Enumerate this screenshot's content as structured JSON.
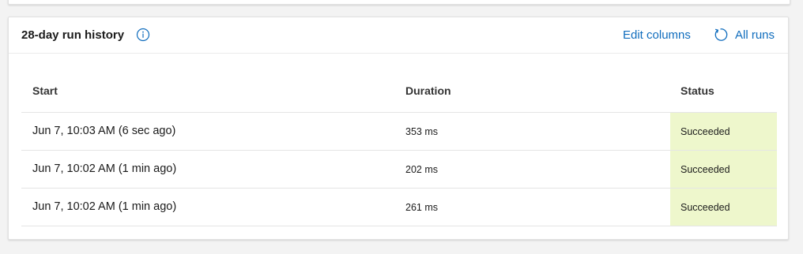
{
  "card": {
    "title": "28-day run history",
    "edit_columns_label": "Edit columns",
    "all_runs_label": "All runs"
  },
  "table": {
    "columns": [
      "Start",
      "Duration",
      "Status"
    ],
    "rows": [
      {
        "start": "Jun 7, 10:03 AM (6 sec ago)",
        "duration": "353 ms",
        "status": "Succeeded"
      },
      {
        "start": "Jun 7, 10:02 AM (1 min ago)",
        "duration": "202 ms",
        "status": "Succeeded"
      },
      {
        "start": "Jun 7, 10:02 AM (1 min ago)",
        "duration": "261 ms",
        "status": "Succeeded"
      }
    ]
  },
  "icons": {
    "info": "info-icon",
    "refresh": "refresh-icon"
  },
  "colors": {
    "link": "#0f6cbd",
    "succeeded_bg": "#eef7cc"
  }
}
